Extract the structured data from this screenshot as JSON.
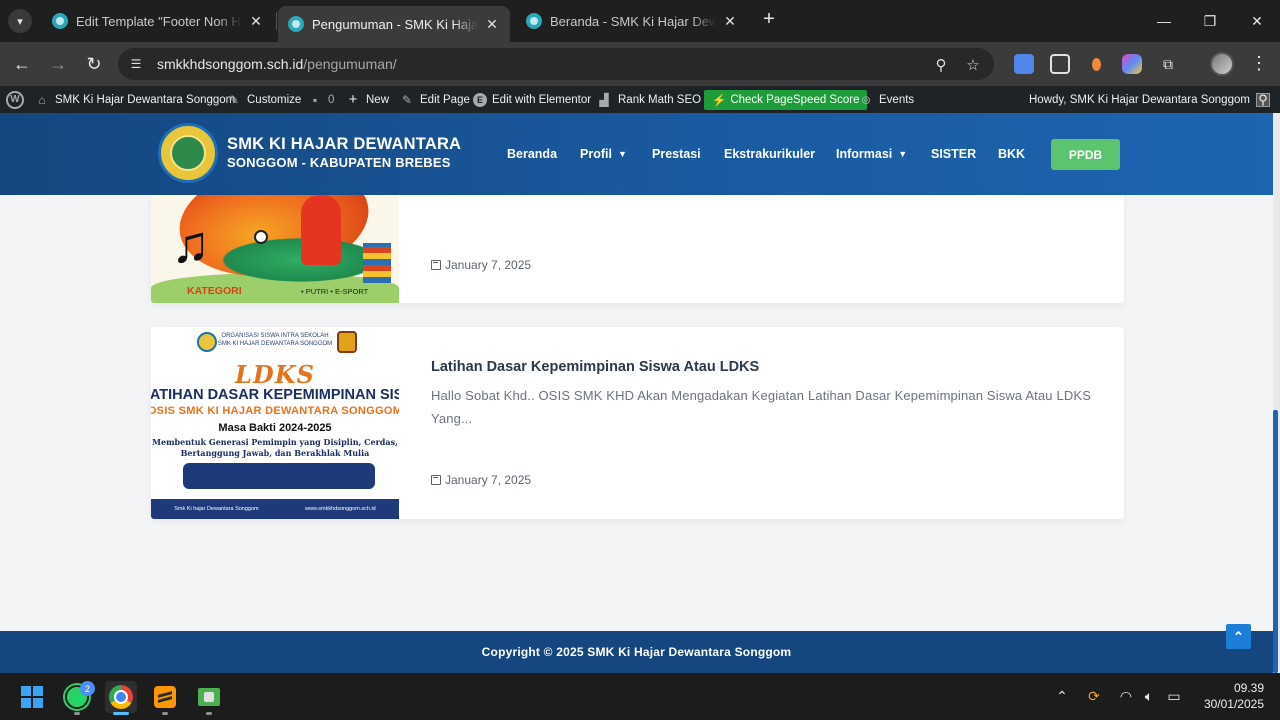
{
  "browser": {
    "tabs": [
      {
        "title": "Edit Template \"Footer Non Hom",
        "active": false
      },
      {
        "title": "Pengumuman - SMK Ki Hajar De",
        "active": true
      },
      {
        "title": "Beranda - SMK Ki Hajar Dewant",
        "active": false
      }
    ],
    "url_domain": "smkkhdsonggom.sch.id",
    "url_path": "/pengumuman/"
  },
  "adminbar": {
    "site_name": "SMK Ki Hajar Dewantara Songgom",
    "customize": "Customize",
    "comments_count": "0",
    "new": "New",
    "edit_page": "Edit Page",
    "edit_elementor": "Edit with Elementor",
    "rank_math": "Rank Math SEO",
    "pagespeed": "Check PageSpeed Score",
    "events": "Events",
    "howdy": "Howdy, SMK Ki Hajar Dewantara Songgom"
  },
  "header": {
    "brand_line1": "SMK KI HAJAR DEWANTARA",
    "brand_line2": "SONGGOM - KABUPATEN BREBES",
    "menu": [
      "Beranda",
      "Profil",
      "Prestasi",
      "Ekstrakurikuler",
      "Informasi",
      "SISTER",
      "BKK"
    ],
    "cta": "PPDB"
  },
  "posts": [
    {
      "title": "",
      "excerpt": "",
      "date": "January 7, 2025",
      "thumb_text": {
        "kategori": "KATEGORI",
        "extra": "• PUTRI • E-SPORT"
      }
    },
    {
      "title": "Latihan Dasar Kepemimpinan Siswa Atau LDKS",
      "excerpt": "Hallo Sobat Khd.. OSIS SMK KHD Akan Mengadakan Kegiatan Latihan Dasar Kepemimpinan Siswa Atau LDKS Yang...",
      "date": "January 7, 2025",
      "thumb_text": {
        "org_line1": "ORGANISASI SISWA INTRA SEKOLAH",
        "org_line2": "SMK KI HAJAR DEWANTARA SONGGOM",
        "ldks": "LDKS",
        "line1": "LATIHAN DASAR KEPEMIMPINAN SISWA",
        "line2": "OSIS SMK KI HAJAR DEWANTARA SONGGOM",
        "line3": "Masa Bakti 2024-2025",
        "line4": "Membentuk Generasi Pemimpin yang Disiplin, Cerdas, Bertanggung Jawab, dan Berakhlak Mulia",
        "footer_left": "Smk Ki hajar Dewantara Songgom",
        "footer_right": "www.smkkhdsonggom.sch.id"
      }
    }
  ],
  "footer": {
    "copyright": "Copyright © 2025 SMK Ki Hajar Dewantara Songgom"
  },
  "taskbar": {
    "whatsapp_badge": "2",
    "time": "09.39",
    "date": "30/01/2025"
  },
  "colors": {
    "header_blue": "#1a5aa0",
    "footer_blue": "#15467f",
    "ppdb_green": "#5cc36e",
    "pagespeed_green": "#1d9c3a"
  }
}
